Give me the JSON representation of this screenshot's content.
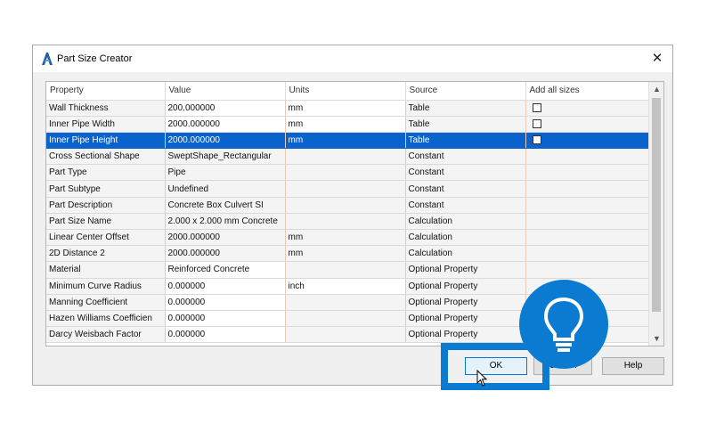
{
  "dialog": {
    "title": "Part Size Creator",
    "close_symbol": "✕",
    "app_icon": "autodesk-civil-icon"
  },
  "grid": {
    "columns": [
      "Property",
      "Value",
      "Units",
      "Source",
      "Add all sizes"
    ],
    "rows": [
      {
        "property": "Wall Thickness",
        "value": "200.000000",
        "units": "mm",
        "source": "Table",
        "checkbox": true,
        "value_editable": true,
        "units_editable": true
      },
      {
        "property": "Inner Pipe Width",
        "value": "2000.000000",
        "units": "mm",
        "source": "Table",
        "checkbox": true,
        "value_editable": true,
        "units_editable": true
      },
      {
        "property": "Inner Pipe Height",
        "value": "2000.000000",
        "units": "mm",
        "source": "Table",
        "checkbox": true,
        "selected": true
      },
      {
        "property": "Cross Sectional Shape",
        "value": "SweptShape_Rectangular",
        "units": "",
        "source": "Constant",
        "checkbox": false
      },
      {
        "property": "Part Type",
        "value": "Pipe",
        "units": "",
        "source": "Constant",
        "checkbox": false
      },
      {
        "property": "Part Subtype",
        "value": "Undefined",
        "units": "",
        "source": "Constant",
        "checkbox": false
      },
      {
        "property": "Part Description",
        "value": "Concrete Box Culvert SI",
        "units": "",
        "source": "Constant",
        "checkbox": false
      },
      {
        "property": "Part Size Name",
        "value": "2.000 x 2.000 mm Concrete",
        "units": "",
        "source": "Calculation",
        "checkbox": false
      },
      {
        "property": "Linear Center Offset",
        "value": "2000.000000",
        "units": "mm",
        "source": "Calculation",
        "checkbox": false
      },
      {
        "property": "2D Distance 2",
        "value": "2000.000000",
        "units": "mm",
        "source": "Calculation",
        "checkbox": false
      },
      {
        "property": "Material",
        "value": "Reinforced Concrete",
        "units": "",
        "source": "Optional Property",
        "checkbox": false,
        "value_editable": true
      },
      {
        "property": "Minimum Curve Radius",
        "value": "0.000000",
        "units": "inch",
        "source": "Optional Property",
        "checkbox": false,
        "value_editable": true,
        "units_editable": true
      },
      {
        "property": "Manning Coefficient",
        "value": "0.000000",
        "units": "",
        "source": "Optional Property",
        "checkbox": false,
        "value_editable": true
      },
      {
        "property": "Hazen Williams Coefficien",
        "value": "0.000000",
        "units": "",
        "source": "Optional Property",
        "checkbox": false,
        "value_editable": true
      },
      {
        "property": "Darcy Weisbach Factor",
        "value": "0.000000",
        "units": "",
        "source": "Optional Property",
        "checkbox": false,
        "value_editable": true
      }
    ]
  },
  "buttons": {
    "ok": "OK",
    "cancel": "Cancel",
    "help": "Help"
  },
  "scrollbar": {
    "up_symbol": "▲",
    "down_symbol": "▼"
  },
  "overlay": {
    "badge_icon": "lightbulb-icon",
    "highlight_color": "#0a7bd1"
  },
  "colors": {
    "selected_row": "#0a63cc",
    "accent": "#0a7bd1"
  }
}
